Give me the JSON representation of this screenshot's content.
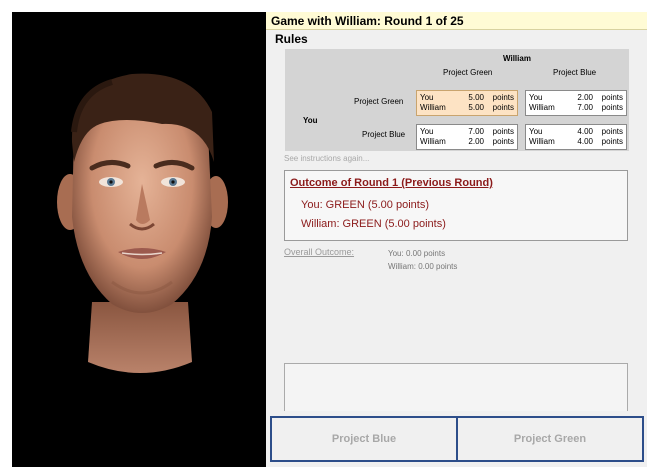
{
  "game": {
    "title": "Game with William: Round 1 of 25",
    "rules_label": "Rules"
  },
  "payoff": {
    "opponent": "William",
    "player": "You",
    "col_headers": [
      "Project Green",
      "Project Blue"
    ],
    "row_headers": [
      "Project Green",
      "Project Blue"
    ],
    "cells": [
      [
        {
          "you_label": "You",
          "you_value": "5.00",
          "opp_label": "William",
          "opp_value": "5.00",
          "unit": "points"
        },
        {
          "you_label": "You",
          "you_value": "2.00",
          "opp_label": "William",
          "opp_value": "7.00",
          "unit": "points"
        }
      ],
      [
        {
          "you_label": "You",
          "you_value": "7.00",
          "opp_label": "William",
          "opp_value": "2.00",
          "unit": "points"
        },
        {
          "you_label": "You",
          "you_value": "4.00",
          "opp_label": "William",
          "opp_value": "4.00",
          "unit": "points"
        }
      ]
    ]
  },
  "instructions_link": "See instructions again...",
  "outcome": {
    "title": "Outcome of Round 1 (Previous Round)",
    "you_line": "You: GREEN (5.00 points)",
    "opp_line": "William: GREEN (5.00 points)"
  },
  "overall": {
    "label": "Overall Outcome:",
    "you": "You: 0.00 points",
    "opp": "William: 0.00 points"
  },
  "buttons": {
    "blue": "Project Blue",
    "green": "Project Green"
  },
  "colors": {
    "title_bar_bg": "#fffbd5",
    "highlight_cell": "#fde3c4",
    "outcome_text": "#8b1a1a",
    "button_border": "#2d4e8a"
  },
  "icons": {
    "avatar": "male-3d-face"
  }
}
